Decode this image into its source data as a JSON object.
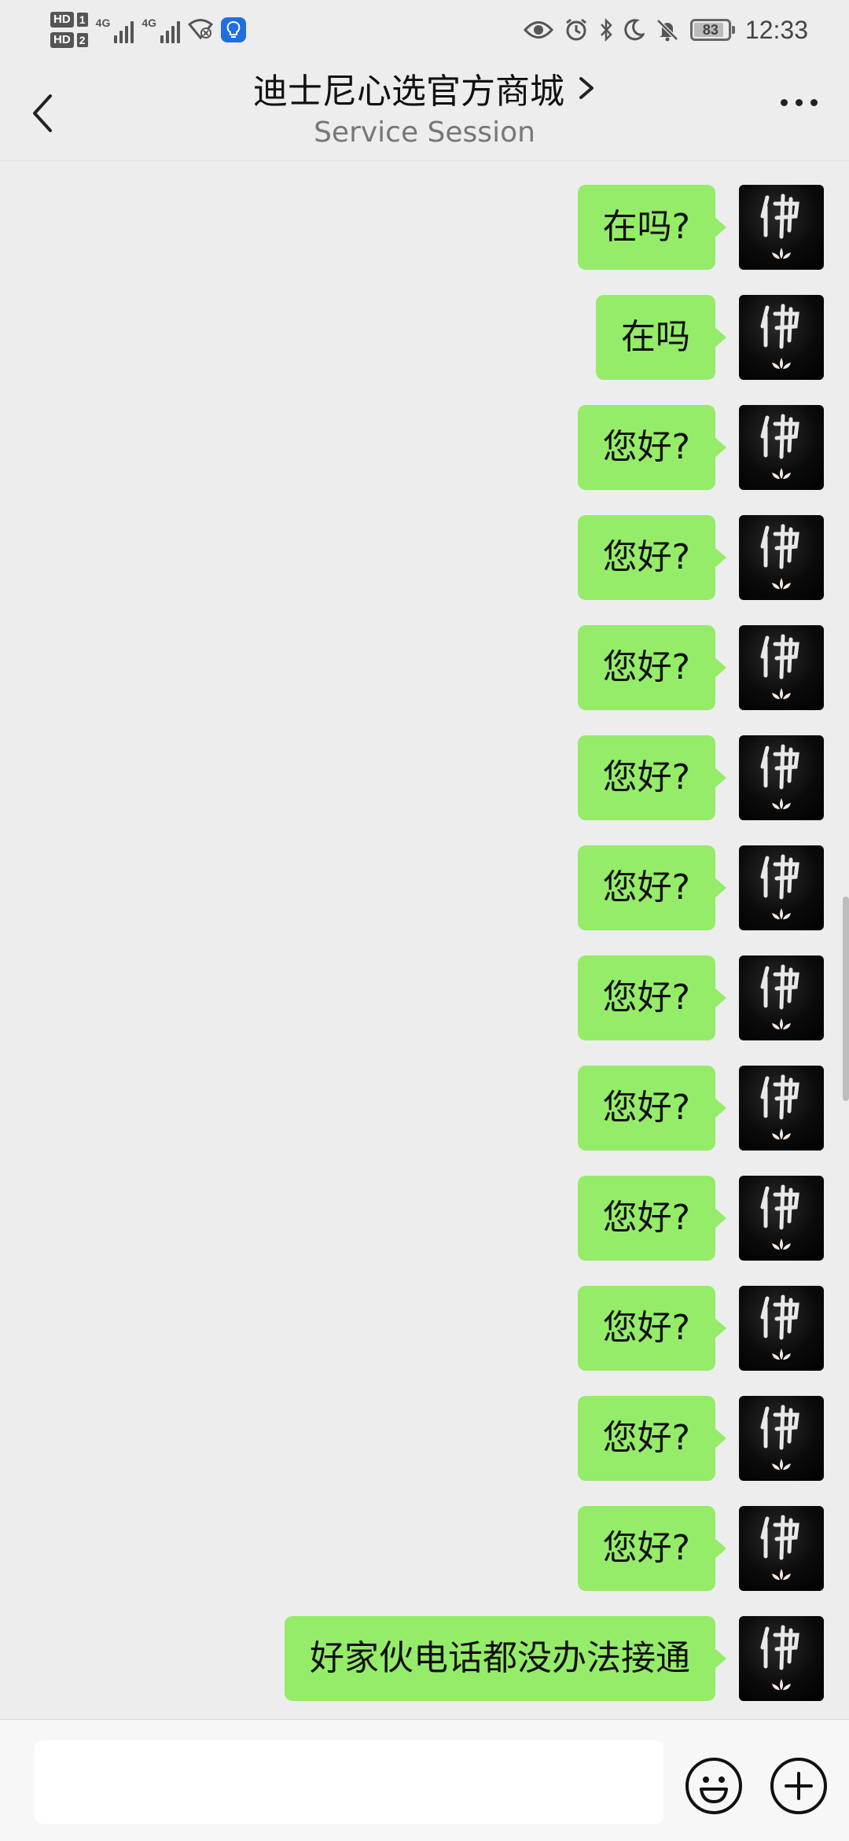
{
  "status_bar": {
    "sim1_tag": "HD",
    "sim1_num": "1",
    "sim2_tag": "HD",
    "sim2_num": "2",
    "network1": "4G",
    "network2": "4G",
    "battery": "83",
    "time": "12:33",
    "icons": [
      "wifi-off-icon",
      "bulb-icon",
      "eye-icon",
      "alarm-icon",
      "bluetooth-icon",
      "moon-icon",
      "bell-muted-icon"
    ]
  },
  "header": {
    "title": "迪士尼心选官方商城",
    "subtitle": "Service Session"
  },
  "messages": [
    {
      "text": "在吗?"
    },
    {
      "text": "在吗"
    },
    {
      "text": "您好?"
    },
    {
      "text": "您好?"
    },
    {
      "text": "您好?"
    },
    {
      "text": "您好?"
    },
    {
      "text": "您好?"
    },
    {
      "text": "您好?"
    },
    {
      "text": "您好?"
    },
    {
      "text": "您好?"
    },
    {
      "text": "您好?"
    },
    {
      "text": "您好?"
    },
    {
      "text": "您好?"
    },
    {
      "text": "好家伙电话都没办法接通"
    }
  ],
  "input": {
    "value": "",
    "placeholder": ""
  },
  "colors": {
    "bubble": "#95ec69",
    "background": "#ededed",
    "bulb_accent": "#1f6fe0"
  }
}
